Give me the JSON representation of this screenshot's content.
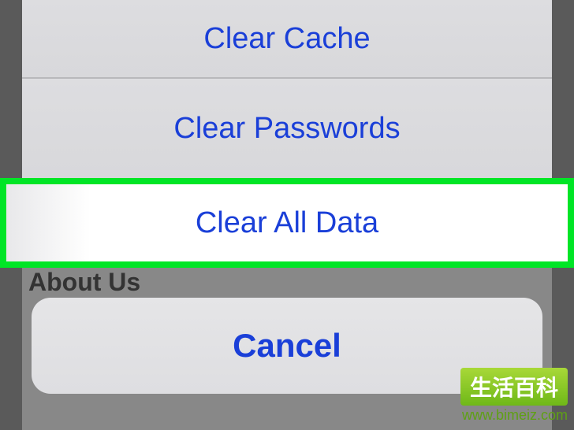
{
  "actionSheet": {
    "options": [
      {
        "label": "Clear Cache"
      },
      {
        "label": "Clear Passwords"
      },
      {
        "label": "Clear All Data"
      }
    ],
    "cancel": "Cancel"
  },
  "background": {
    "aboutUs": "About Us"
  },
  "watermark": {
    "title": "生活百科",
    "url": "www.bimeiz.com"
  }
}
